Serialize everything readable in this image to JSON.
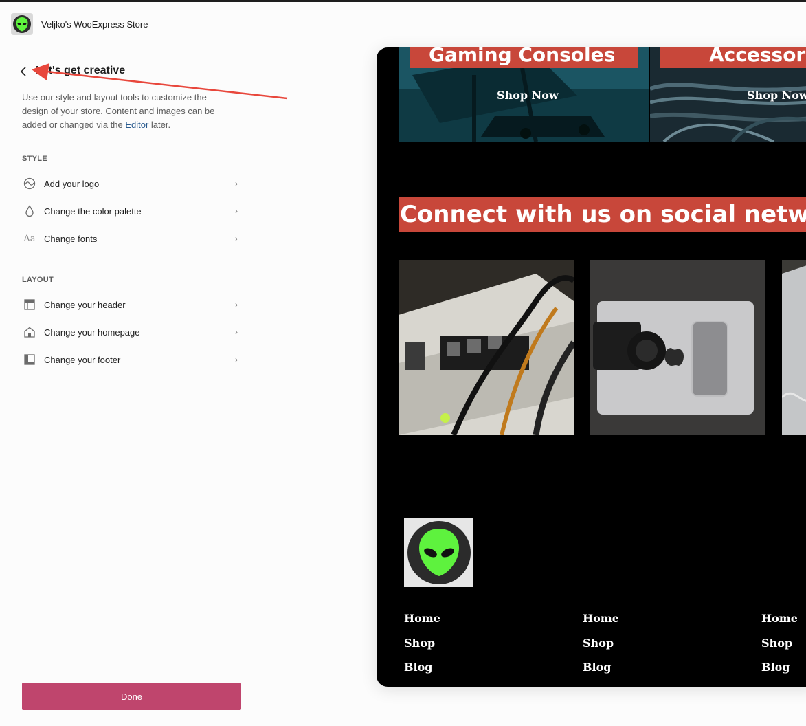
{
  "store": {
    "name": "Veljko's WooExpress Store",
    "icon": "alien-head-icon"
  },
  "panel": {
    "title": "Let's get creative",
    "description_prefix": "Use our style and layout tools to customize the design of your store. Content and images can be added or changed via the ",
    "editor_link": "Editor",
    "description_suffix": " later."
  },
  "style_section": {
    "label": "STYLE",
    "items": [
      {
        "label": "Add your logo",
        "icon": "logo-icon"
      },
      {
        "label": "Change the color palette",
        "icon": "droplet-icon"
      },
      {
        "label": "Change fonts",
        "icon": "typography-icon",
        "glyph": "Aa"
      }
    ]
  },
  "layout_section": {
    "label": "LAYOUT",
    "items": [
      {
        "label": "Change your header",
        "icon": "header-layout-icon"
      },
      {
        "label": "Change your homepage",
        "icon": "home-icon"
      },
      {
        "label": "Change your footer",
        "icon": "footer-layout-icon"
      }
    ]
  },
  "done_label": "Done",
  "preview": {
    "promos": [
      {
        "title": "Gaming Consoles",
        "link": "Shop Now"
      },
      {
        "title": "Accessories",
        "link": "Shop Now"
      }
    ],
    "connect_heading": "Connect with us on social networks",
    "footer_columns": [
      [
        "Home",
        "Shop",
        "Blog"
      ],
      [
        "Home",
        "Shop",
        "Blog"
      ],
      [
        "Home",
        "Shop",
        "Blog"
      ]
    ]
  },
  "colors": {
    "accent": "#bf456d",
    "promo_red": "#c8473a",
    "alien_green": "#5ef23e",
    "annotation_arrow": "#e8473c"
  }
}
